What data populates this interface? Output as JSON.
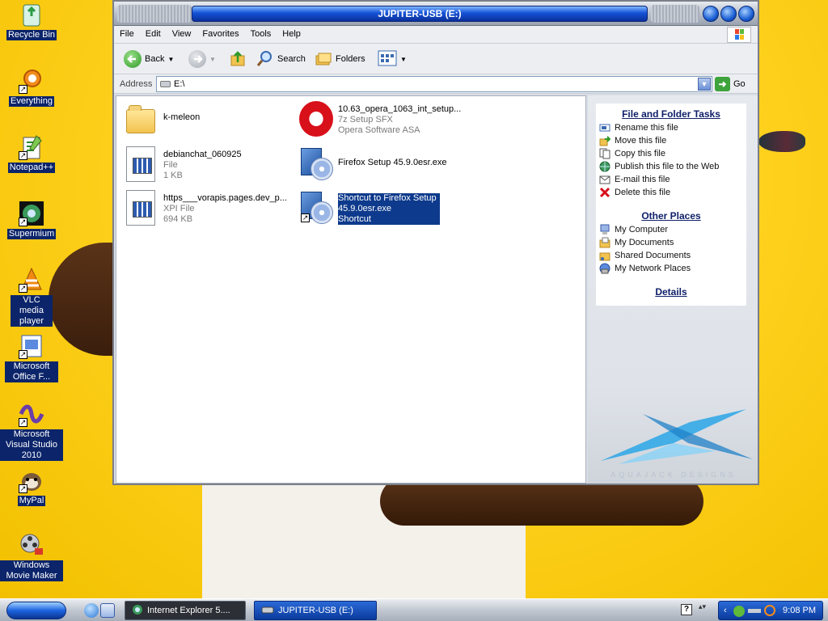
{
  "desktop": {
    "icons": [
      {
        "label": "Recycle Bin",
        "icon": "recycle-bin-icon"
      },
      {
        "label": "Everything",
        "icon": "everything-icon"
      },
      {
        "label": "Notepad++",
        "icon": "notepad-plus-plus-icon"
      },
      {
        "label": "Supermium",
        "icon": "supermium-icon"
      },
      {
        "label": "VLC media player",
        "icon": "vlc-icon"
      },
      {
        "label": "Microsoft Office F...",
        "icon": "office-icon"
      },
      {
        "label": "Microsoft Visual Studio 2010",
        "icon": "visual-studio-icon"
      },
      {
        "label": "MyPal",
        "icon": "mypal-icon"
      },
      {
        "label": "Windows Movie Maker",
        "icon": "movie-maker-icon"
      }
    ]
  },
  "window": {
    "title": "JUPITER-USB (E:)",
    "menu": [
      "File",
      "Edit",
      "View",
      "Favorites",
      "Tools",
      "Help"
    ],
    "toolbar": {
      "back": "Back",
      "search": "Search",
      "folders": "Folders"
    },
    "address": {
      "label": "Address",
      "value": "E:\\",
      "go": "Go"
    },
    "files": [
      {
        "name": "k-meleon",
        "line2": "",
        "line3": "",
        "icon": "folder-icon"
      },
      {
        "name": "debianchat_060925",
        "line2": "File",
        "line3": "1 KB",
        "icon": "generic-file-icon"
      },
      {
        "name": "https___vorapis.pages.dev_p...",
        "line2": "XPI File",
        "line3": "694 KB",
        "icon": "generic-file-icon"
      },
      {
        "name": "10.63_opera_1063_int_setup...",
        "line2": "7z Setup SFX",
        "line3": "Opera Software ASA",
        "icon": "opera-icon"
      },
      {
        "name": "Firefox Setup 45.9.0esr.exe",
        "line2": "",
        "line3": "",
        "icon": "setup-cd-icon"
      },
      {
        "name": "Shortcut to Firefox Setup",
        "line2": "45.9.0esr.exe",
        "line3": "Shortcut",
        "icon": "setup-cd-shortcut-icon"
      }
    ],
    "tasks": {
      "file_folder_title": "File and Folder Tasks",
      "file_folder_items": [
        "Rename this file",
        "Move this file",
        "Copy this file",
        "Publish this file to the Web",
        "E-mail this file",
        "Delete this file"
      ],
      "other_places_title": "Other Places",
      "other_places_items": [
        "My Computer",
        "My Documents",
        "Shared Documents",
        "My Network Places"
      ],
      "details_title": "Details",
      "logo_text": "AQUAJACK DESIGNS"
    }
  },
  "taskbar": {
    "tasks": [
      {
        "label": "Internet Explorer 5....",
        "active": false
      },
      {
        "label": "JUPITER-USB (E:)",
        "active": true
      }
    ],
    "clock": "9:08 PM"
  }
}
